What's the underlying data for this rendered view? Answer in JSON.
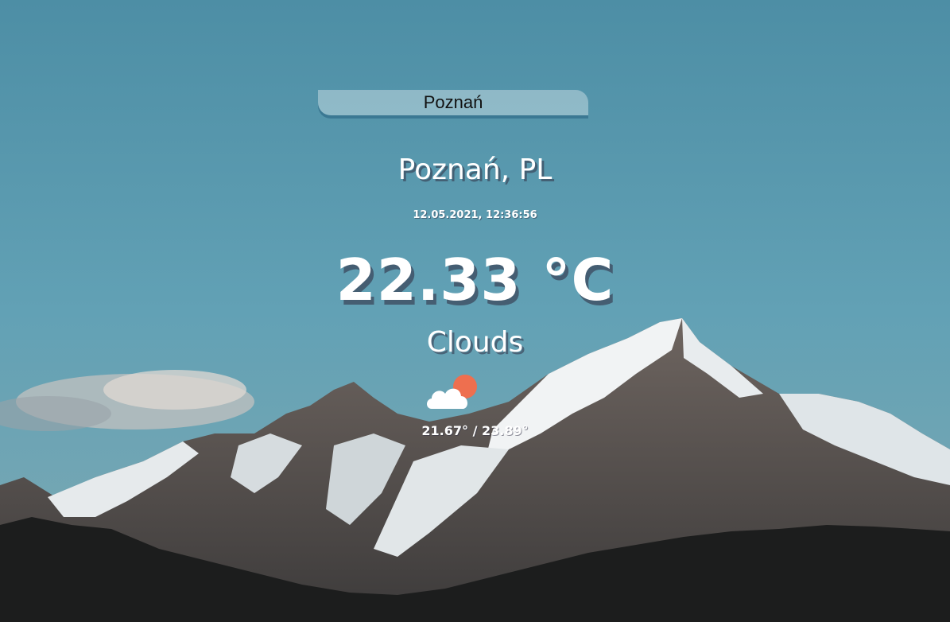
{
  "search": {
    "value": "Poznań"
  },
  "location": {
    "label": "Poznań, PL"
  },
  "datetime": "12.05.2021, 12:36:56",
  "temperature": {
    "value": "22.33 °C"
  },
  "weather": {
    "description": "Clouds",
    "icon": "cloud-sun-icon"
  },
  "minmax": "21.67° / 23.89°"
}
